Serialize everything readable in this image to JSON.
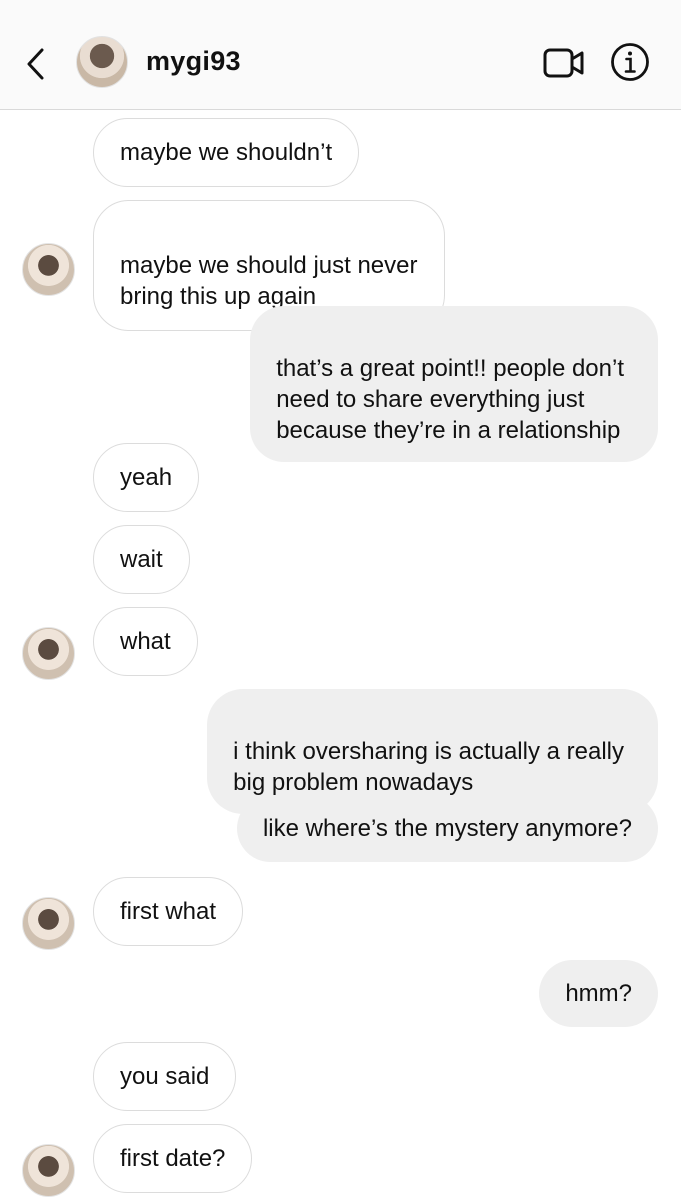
{
  "header": {
    "username": "mygi93",
    "back_icon": "chevron-left-icon",
    "video_icon": "video-camera-icon",
    "info_icon": "info-icon"
  },
  "messages": [
    {
      "from": "them",
      "text": "maybe we shouldn’t"
    },
    {
      "from": "them",
      "text": "maybe we should just never\nbring this up again"
    },
    {
      "from": "me",
      "text": "that’s a great point!! people don’t\nneed to share everything just\nbecause they’re in a relationship"
    },
    {
      "from": "them",
      "text": "yeah"
    },
    {
      "from": "them",
      "text": "wait"
    },
    {
      "from": "them",
      "text": "what"
    },
    {
      "from": "me",
      "text": "i think oversharing is actually a really\nbig problem nowadays"
    },
    {
      "from": "me",
      "text": "like where’s the mystery anymore?"
    },
    {
      "from": "them",
      "text": "first what"
    },
    {
      "from": "me",
      "text": "hmm?"
    },
    {
      "from": "them",
      "text": "you said"
    },
    {
      "from": "them",
      "text": "first date?"
    }
  ],
  "colors": {
    "header_bg": "#fafafa",
    "sent_bubble": "#efefef",
    "received_border": "#dcdcdc"
  }
}
